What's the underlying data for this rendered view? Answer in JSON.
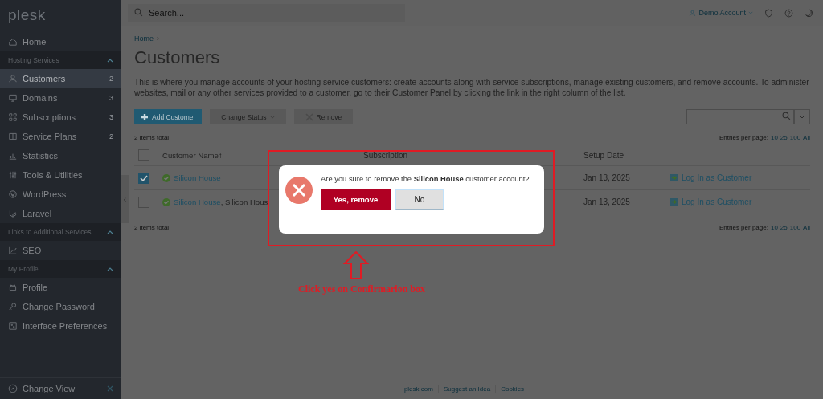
{
  "sidebar": {
    "logo": "plesk",
    "items": [
      {
        "kind": "item",
        "label": "Home",
        "selected": false
      },
      {
        "kind": "section",
        "label": "Hosting Services",
        "expanded": true
      },
      {
        "kind": "item",
        "label": "Customers",
        "count": "2",
        "selected": true
      },
      {
        "kind": "item",
        "label": "Domains",
        "count": "3",
        "selected": false
      },
      {
        "kind": "item",
        "label": "Subscriptions",
        "count": "3",
        "selected": false
      },
      {
        "kind": "item",
        "label": "Service Plans",
        "count": "2",
        "selected": false
      },
      {
        "kind": "item",
        "label": "Statistics",
        "selected": false
      },
      {
        "kind": "item",
        "label": "Tools & Utilities",
        "selected": false
      },
      {
        "kind": "item",
        "label": "WordPress",
        "selected": false
      },
      {
        "kind": "item",
        "label": "Laravel",
        "selected": false
      },
      {
        "kind": "section",
        "label": "Links to Additional Services",
        "expanded": true
      },
      {
        "kind": "item",
        "label": "SEO",
        "selected": false
      },
      {
        "kind": "section",
        "label": "My Profile",
        "expanded": true
      },
      {
        "kind": "item",
        "label": "Profile",
        "selected": false
      },
      {
        "kind": "item",
        "label": "Change Password",
        "selected": false
      },
      {
        "kind": "item",
        "label": "Interface Preferences",
        "selected": false
      }
    ],
    "footer": "Change View"
  },
  "topbar": {
    "search_placeholder": "Search...",
    "account": "Demo Account"
  },
  "breadcrumb": [
    "Home"
  ],
  "breadcrumb_sep": "›",
  "title": "Customers",
  "description": "This is where you manage accounts of your hosting service customers: create accounts along with service subscriptions, manage existing customers, and remove accounts. To administer websites, mail or any other services provided to a customer, go to their Customer Panel by clicking the link in the right column of the list.",
  "toolbar": [
    {
      "label": "Add Customer",
      "kind": "primary"
    },
    {
      "label": "Change Status",
      "kind": "dropdown"
    },
    {
      "label": "Remove",
      "kind": "remove"
    }
  ],
  "total_top": "2 items total",
  "total_bottom": "2 items total",
  "entries_top": {
    "label": "Entries per page:",
    "options": [
      "10",
      "25",
      "100",
      "All"
    ]
  },
  "entries_bottom": {
    "label": "Entries per page:",
    "options": [
      "10",
      "25",
      "100",
      "All"
    ]
  },
  "collapse_mark": "‹",
  "table": {
    "select_all_checked": false,
    "columns": [
      "Customer Name",
      "Subscription",
      "Setup Date"
    ],
    "sort_mark": "↑",
    "rows": [
      {
        "checked": true,
        "name": "Silicon House",
        "extra": "",
        "setup_date": "Jan 13, 2025",
        "action": "Log In as Customer"
      },
      {
        "checked": false,
        "name": "Silicon House",
        "extra": ", Silicon Hous",
        "setup_date": "Jan 13, 2025",
        "action": "Log In as Customer"
      }
    ]
  },
  "dialog": {
    "message": "Are you sure to remove the **Silicon House** customer account?",
    "confirm": "Yes, remove",
    "cancel": "No"
  },
  "annotation": "Click yes on Confirmarion box",
  "footer_links": [
    "plesk.com",
    "Suggest an Idea",
    "Cookies"
  ]
}
